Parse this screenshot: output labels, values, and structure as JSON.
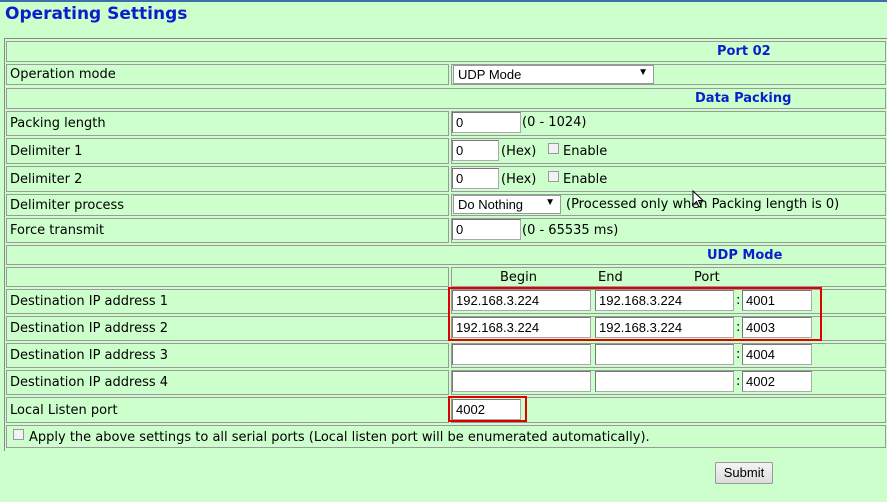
{
  "page_title": "Operating Settings",
  "port_header": "Port 02",
  "operation_mode": {
    "label": "Operation mode",
    "value": "UDP Mode"
  },
  "data_packing": {
    "header": "Data Packing",
    "packing_length": {
      "label": "Packing length",
      "value": "0",
      "hint": "(0 - 1024)"
    },
    "delimiter1": {
      "label": "Delimiter 1",
      "value": "0",
      "hex": "(Hex)",
      "enable": "Enable"
    },
    "delimiter2": {
      "label": "Delimiter 2",
      "value": "0",
      "hex": "(Hex)",
      "enable": "Enable"
    },
    "delimiter_process": {
      "label": "Delimiter process",
      "value": "Do Nothing",
      "hint": "(Processed only when Packing length is 0)"
    },
    "force_transmit": {
      "label": "Force transmit",
      "value": "0",
      "hint": "(0 - 65535 ms)"
    }
  },
  "udp_mode": {
    "header": "UDP Mode",
    "col_begin": "Begin",
    "col_end": "End",
    "col_port": "Port",
    "colon": ":",
    "destinations": [
      {
        "label": "Destination IP address 1",
        "begin": "192.168.3.224",
        "end": "192.168.3.224",
        "port": "4001"
      },
      {
        "label": "Destination IP address 2",
        "begin": "192.168.3.224",
        "end": "192.168.3.224",
        "port": "4003"
      },
      {
        "label": "Destination IP address 3",
        "begin": "",
        "end": "",
        "port": "4004"
      },
      {
        "label": "Destination IP address 4",
        "begin": "",
        "end": "",
        "port": "4002"
      }
    ],
    "local_listen": {
      "label": "Local Listen port",
      "value": "4002"
    }
  },
  "apply_all_label": "Apply the above settings to all serial ports (Local listen port will be enumerated automatically).",
  "submit_label": "Submit",
  "colors": {
    "background": "#ccffcc",
    "header_text": "#0a1fcc",
    "highlight": "#e00000"
  }
}
